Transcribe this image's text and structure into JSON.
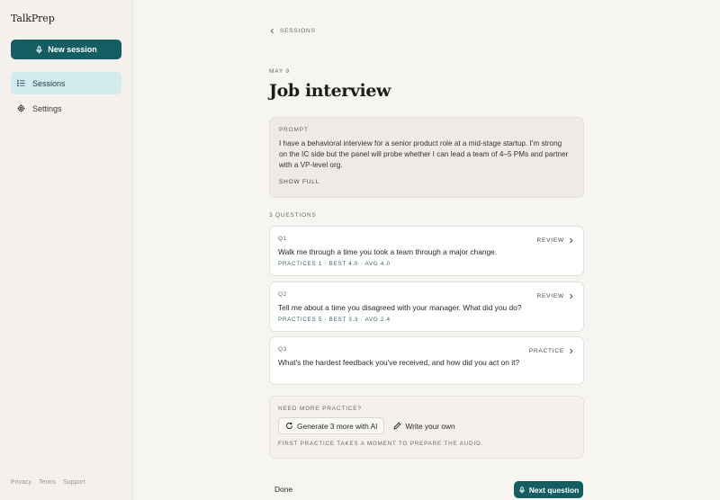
{
  "app": {
    "name": "TalkPrep"
  },
  "sidebar": {
    "new_session_label": "New session",
    "items": [
      {
        "label": "Sessions",
        "icon": "list-icon",
        "active": true
      },
      {
        "label": "Settings",
        "icon": "gear-icon",
        "active": false
      }
    ],
    "footer_links": [
      "Privacy",
      "Terms",
      "Support"
    ]
  },
  "main": {
    "back_label": "SESSIONS",
    "date": "MAY 9",
    "title": "Job interview",
    "prompt": {
      "label": "PROMPT",
      "text": "I have a behavioral interview for a senior product role at a mid-stage startup. I'm strong on the IC side but the panel will probe whether I can lead a team of 4–5 PMs and partner with a VP-level org.",
      "show_full_label": "SHOW FULL"
    },
    "questions_count_label": "3 QUESTIONS",
    "questions": [
      {
        "num": "Q1",
        "text": "Walk me through a time you took a team through a major change.",
        "stats": "PRACTICES 1 · BEST 4.0 · AVG 4.0",
        "action": "REVIEW"
      },
      {
        "num": "Q2",
        "text": "Tell me about a time you disagreed with your manager. What did you do?",
        "stats": "PRACTICES 5 · BEST 3.3 · AVG 2.4",
        "action": "REVIEW"
      },
      {
        "num": "Q3",
        "text": "What's the hardest feedback you've received, and how did you act on it?",
        "stats": "",
        "action": "PRACTICE"
      }
    ],
    "more": {
      "label": "NEED MORE PRACTICE?",
      "generate_label": "Generate 3 more with AI",
      "write_label": "Write your own",
      "note": "FIRST PRACTICE TAKES A MOMENT TO PREPARE THE AUDIO."
    },
    "done_label": "Done",
    "next_label": "Next question"
  },
  "colors": {
    "accent": "#135e63",
    "active_nav": "#d3eaef",
    "background": "#f7f5f2"
  }
}
